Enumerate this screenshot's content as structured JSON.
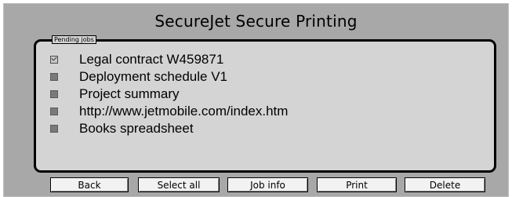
{
  "window": {
    "title": "SecureJet Secure Printing"
  },
  "panel": {
    "legend": "Pending jobs"
  },
  "jobs": [
    {
      "label": "Legal contract W459871",
      "checked": true
    },
    {
      "label": "Deployment schedule V1",
      "checked": false
    },
    {
      "label": "Project summary",
      "checked": false
    },
    {
      "label": "http://www.jetmobile.com/index.htm",
      "checked": false
    },
    {
      "label": "Books spreadsheet",
      "checked": false
    }
  ],
  "buttons": {
    "back": "Back",
    "select_all": "Select all",
    "job_info": "Job info",
    "print": "Print",
    "delete": "Delete"
  },
  "colors": {
    "background": "#a8a8a8",
    "panel": "#d4d4d4",
    "button": "#f2f2f2"
  }
}
